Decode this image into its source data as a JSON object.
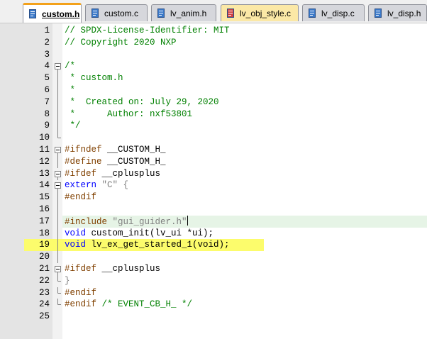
{
  "tabs": [
    {
      "label": "custom.h",
      "state": "active",
      "icon": "file-icon"
    },
    {
      "label": "custom.c",
      "state": "normal",
      "icon": "file-icon"
    },
    {
      "label": "lv_anim.h",
      "state": "normal",
      "icon": "file-icon"
    },
    {
      "label": "lv_obj_style.c",
      "state": "modified",
      "icon": "file-icon"
    },
    {
      "label": "lv_disp.c",
      "state": "normal",
      "icon": "file-icon"
    },
    {
      "label": "lv_disp.h",
      "state": "normal",
      "icon": "file-icon"
    }
  ],
  "colors": {
    "active_tab_accent": "#f3a11a",
    "comment": "#008000",
    "keyword": "#0000ff",
    "preprocessor": "#804000",
    "current_line": "#e6f4e6",
    "highlight": "#fcfc6c"
  },
  "editor": {
    "lines": [
      {
        "n": "1",
        "segments": [
          {
            "t": "// SPDX-License-Identifier: MIT",
            "c": "comment"
          }
        ]
      },
      {
        "n": "2",
        "segments": [
          {
            "t": "// Copyright 2020 NXP",
            "c": "comment"
          }
        ]
      },
      {
        "n": "3",
        "segments": []
      },
      {
        "n": "4",
        "segments": [
          {
            "t": "/*",
            "c": "comment"
          }
        ],
        "fold": "open"
      },
      {
        "n": "5",
        "segments": [
          {
            "t": " * custom.h",
            "c": "comment"
          }
        ],
        "fold": "line"
      },
      {
        "n": "6",
        "segments": [
          {
            "t": " *",
            "c": "comment"
          }
        ],
        "fold": "line"
      },
      {
        "n": "7",
        "segments": [
          {
            "t": " *  Created on: July 29, 2020",
            "c": "comment"
          }
        ],
        "fold": "line"
      },
      {
        "n": "8",
        "segments": [
          {
            "t": " *      Author: nxf53801",
            "c": "comment"
          }
        ],
        "fold": "line"
      },
      {
        "n": "9",
        "segments": [
          {
            "t": " */",
            "c": "comment"
          }
        ],
        "fold": "line"
      },
      {
        "n": "10",
        "segments": [],
        "fold": "end"
      },
      {
        "n": "11",
        "segments": [
          {
            "t": "#ifndef",
            "c": "pre"
          },
          {
            "t": " __CUSTOM_H_",
            "c": "plain"
          }
        ],
        "fold": "open"
      },
      {
        "n": "12",
        "segments": [
          {
            "t": "#define",
            "c": "pre"
          },
          {
            "t": " __CUSTOM_H_",
            "c": "plain"
          }
        ],
        "fold": "line"
      },
      {
        "n": "13",
        "segments": [
          {
            "t": "#ifdef",
            "c": "pre"
          },
          {
            "t": " __cplusplus",
            "c": "plain"
          }
        ],
        "fold": "open"
      },
      {
        "n": "14",
        "segments": [
          {
            "t": "extern",
            "c": "kw"
          },
          {
            "t": " ",
            "c": "plain"
          },
          {
            "t": "\"C\"",
            "c": "str"
          },
          {
            "t": " {",
            "c": "str"
          }
        ],
        "fold": "open"
      },
      {
        "n": "15",
        "segments": [
          {
            "t": "#endif",
            "c": "pre"
          }
        ],
        "fold": "line"
      },
      {
        "n": "16",
        "segments": [],
        "fold": "line"
      },
      {
        "n": "17",
        "segments": [
          {
            "t": "#include",
            "c": "pre"
          },
          {
            "t": " ",
            "c": "plain"
          },
          {
            "t": "\"gui_guider.h\"",
            "c": "str"
          }
        ],
        "fold": "line",
        "current": true
      },
      {
        "n": "18",
        "segments": [
          {
            "t": "void",
            "c": "kw"
          },
          {
            "t": " custom_init(lv_ui *ui);",
            "c": "plain"
          }
        ],
        "fold": "line"
      },
      {
        "n": "19",
        "segments": [
          {
            "t": "void",
            "c": "kw"
          },
          {
            "t": " lv_ex_get_started_1(void);",
            "c": "plain"
          }
        ],
        "fold": "line",
        "highlight": true
      },
      {
        "n": "20",
        "segments": [],
        "fold": "line"
      },
      {
        "n": "21",
        "segments": [
          {
            "t": "#ifdef",
            "c": "pre"
          },
          {
            "t": " __cplusplus",
            "c": "plain"
          }
        ],
        "fold": "open"
      },
      {
        "n": "22",
        "segments": [
          {
            "t": "}",
            "c": "str"
          }
        ],
        "fold": "end"
      },
      {
        "n": "23",
        "segments": [
          {
            "t": "#endif",
            "c": "pre"
          }
        ],
        "fold": "end"
      },
      {
        "n": "24",
        "segments": [
          {
            "t": "#endif",
            "c": "pre"
          },
          {
            "t": " /* EVENT_CB_H_ */",
            "c": "comment"
          }
        ],
        "fold": "end"
      },
      {
        "n": "25",
        "segments": []
      }
    ]
  }
}
